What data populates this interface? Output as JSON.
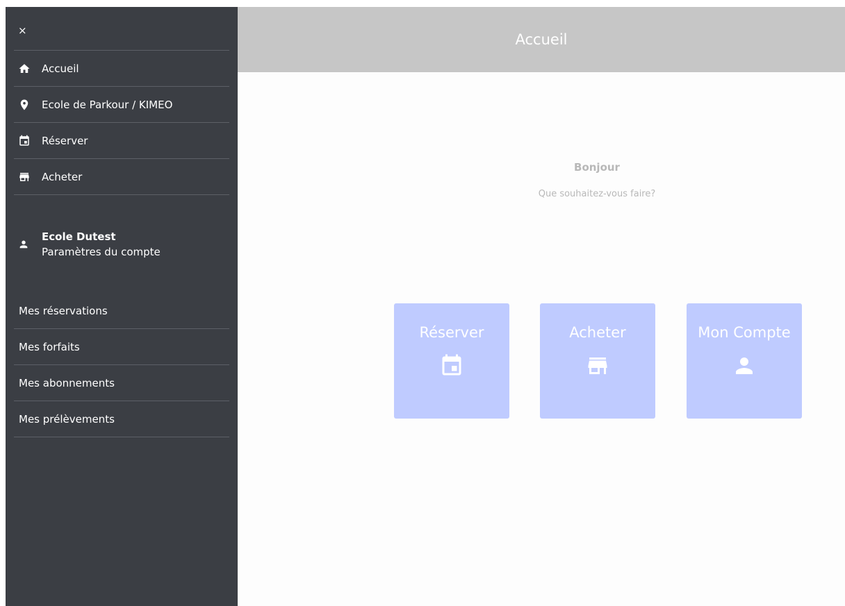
{
  "sidebar": {
    "close_label": "×",
    "nav": [
      {
        "label": "Accueil",
        "icon": "home-icon"
      },
      {
        "label": "Ecole de Parkour / KIMEO",
        "icon": "location-pin-icon"
      },
      {
        "label": "Réserver",
        "icon": "calendar-icon"
      },
      {
        "label": "Acheter",
        "icon": "store-icon"
      }
    ],
    "account": {
      "name": "Ecole Dutest",
      "settings_label": "Paramètres du compte",
      "icon": "user-icon"
    },
    "sub_nav": [
      {
        "label": "Mes réservations"
      },
      {
        "label": "Mes forfaits"
      },
      {
        "label": "Mes abonnements"
      },
      {
        "label": "Mes prélèvements"
      }
    ]
  },
  "header": {
    "title": "Accueil"
  },
  "main": {
    "greeting": "Bonjour",
    "prompt": "Que souhaitez-vous faire?",
    "tiles": [
      {
        "label": "Réserver",
        "icon": "calendar-icon"
      },
      {
        "label": "Acheter",
        "icon": "store-icon"
      },
      {
        "label": "Mon Compte",
        "icon": "user-icon"
      }
    ]
  },
  "colors": {
    "sidebar_bg": "#3b3e44",
    "header_bg": "#c6c6c6",
    "tile_bg": "#bfcbff",
    "muted_text": "#b8b8b8"
  }
}
